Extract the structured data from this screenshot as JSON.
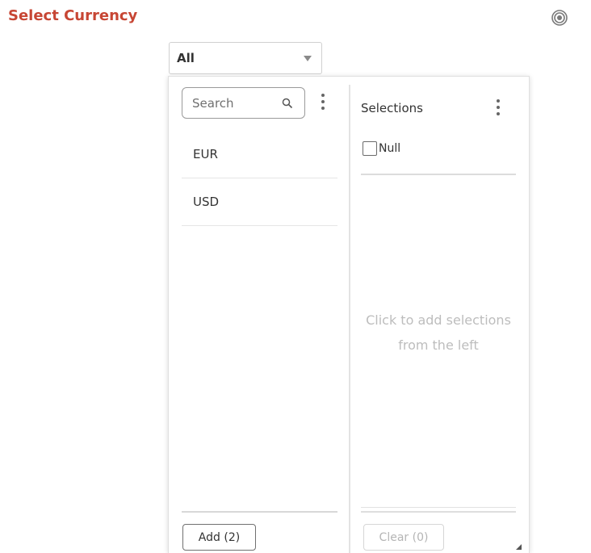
{
  "header": {
    "title": "Select Currency",
    "title_color": "#c74634",
    "icon": "target-icon"
  },
  "dropdown": {
    "value": "All",
    "icon": "caret-down-icon"
  },
  "left_panel": {
    "search": {
      "placeholder": "Search",
      "value": "",
      "icon": "search-icon"
    },
    "menu_icon": "kebab-menu-icon",
    "items": [
      {
        "label": "EUR"
      },
      {
        "label": "USD"
      }
    ],
    "add_button": "Add (2)"
  },
  "right_panel": {
    "label": "Selections",
    "menu_icon": "kebab-menu-icon",
    "null_option": {
      "label": "Null",
      "checked": false
    },
    "empty_message": "Click to add selections from the left",
    "clear_button": "Clear (0)",
    "resize_icon": "resize-handle-icon"
  }
}
